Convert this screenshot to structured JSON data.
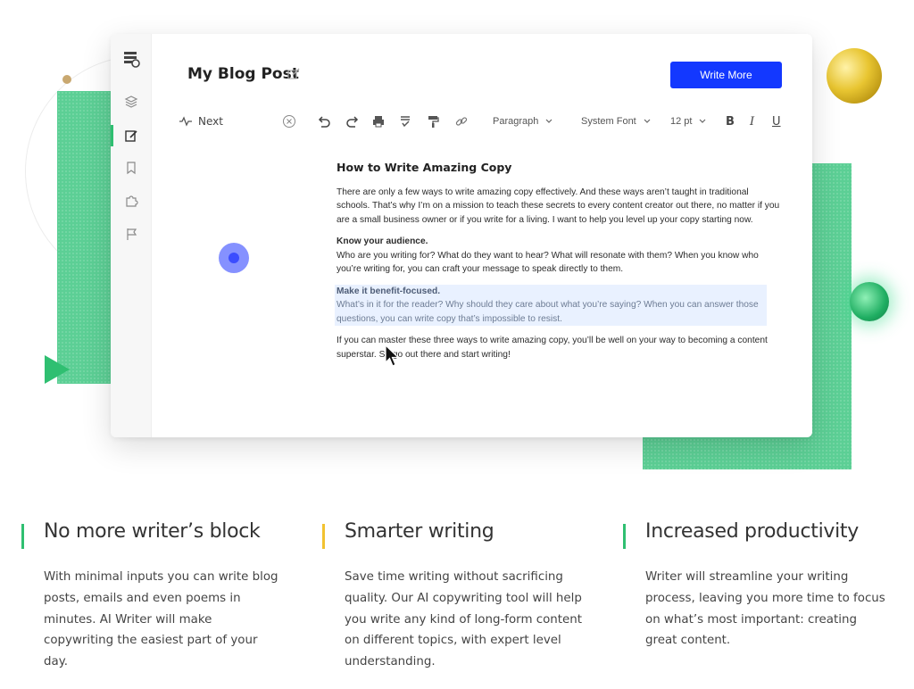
{
  "document": {
    "title": "My Blog Post",
    "write_more_label": "Write More"
  },
  "sidebar": {
    "items": [
      {
        "icon": "layers-icon"
      },
      {
        "icon": "edit-icon",
        "active": true
      },
      {
        "icon": "bookmark-icon"
      },
      {
        "icon": "puzzle-icon"
      },
      {
        "icon": "flag-icon"
      }
    ]
  },
  "toolbar": {
    "next_label": "Next",
    "paragraph_label": "Paragraph",
    "font_label": "System Font",
    "size_label": "12 pt",
    "bold_label": "B",
    "italic_label": "I",
    "underline_label": "U"
  },
  "editor": {
    "heading": "How to Write Amazing Copy",
    "intro": "There are only a few ways to write amazing copy effectively. And these ways aren’t taught in traditional schools. That’s why I’m on a mission to teach these secrets to every content creator out there, no matter if you are a small business owner or if you write for a living. I want to help you level up your copy starting now.",
    "section1_title": "Know your audience.",
    "section1_body": "Who are you writing for? What do they want to hear? What will resonate with them? When you know who you’re writing for, you can craft your message to speak directly to them.",
    "section2_title": "Make it benefit-focused.",
    "section2_body": "What’s in it for the reader? Why should they care about what you’re saying? When you can answer those questions, you can write copy that’s impossible to resist.",
    "conclusion": "If you can master these three ways to write amazing copy, you’ll be well on your way to becoming a content superstar. So go out there and start writing!"
  },
  "features": [
    {
      "title": "No more writer’s block",
      "text": "With minimal inputs you can write blog posts, emails and even poems in minutes. AI Writer will make copywriting the easiest part of your day.",
      "accent": "#2fbf71"
    },
    {
      "title": "Smarter writing",
      "text": "Save time writing without sacrificing quality. Our AI copywriting tool will help you write any kind of long-form content on different topics, with expert level understanding.",
      "accent": "#f2c230"
    },
    {
      "title": "Increased productivity",
      "text": "Writer will streamline your writing process, leaving you more time to focus on what’s most important: creating great content.",
      "accent": "#2fbf71"
    }
  ],
  "colors": {
    "primary_button": "#1338ff",
    "green_accent": "#2fbf71",
    "highlight": "#e9f1ff"
  }
}
